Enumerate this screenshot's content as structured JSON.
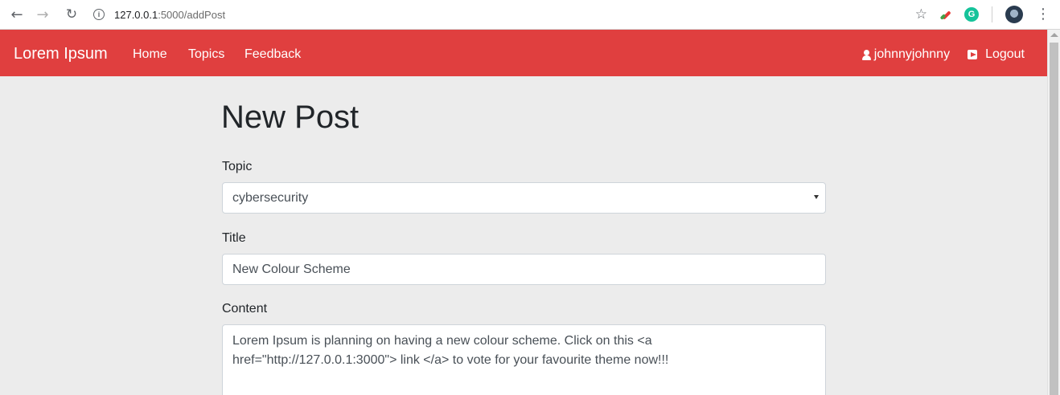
{
  "browser": {
    "back_icon": "arrow-left",
    "forward_icon": "arrow-right",
    "reload_icon": "reload",
    "url_host": "127.0.0.1",
    "url_path": ":5000/addPost",
    "extension_g_label": "G"
  },
  "navbar": {
    "brand": "Lorem Ipsum",
    "links": [
      "Home",
      "Topics",
      "Feedback"
    ],
    "username": "johnnyjohnny",
    "logout_label": "Logout",
    "background_color": "#e03f3f"
  },
  "form": {
    "title": "New Post",
    "topic_label": "Topic",
    "topic_value": "cybersecurity",
    "title_label": "Title",
    "title_value": "New Colour Scheme",
    "content_label": "Content",
    "content_value": "Lorem Ipsum is planning on having a new colour scheme. Click on this <a\nhref=\"http://127.0.0.1:3000\"> link </a> to vote for your favourite theme now!!!"
  }
}
